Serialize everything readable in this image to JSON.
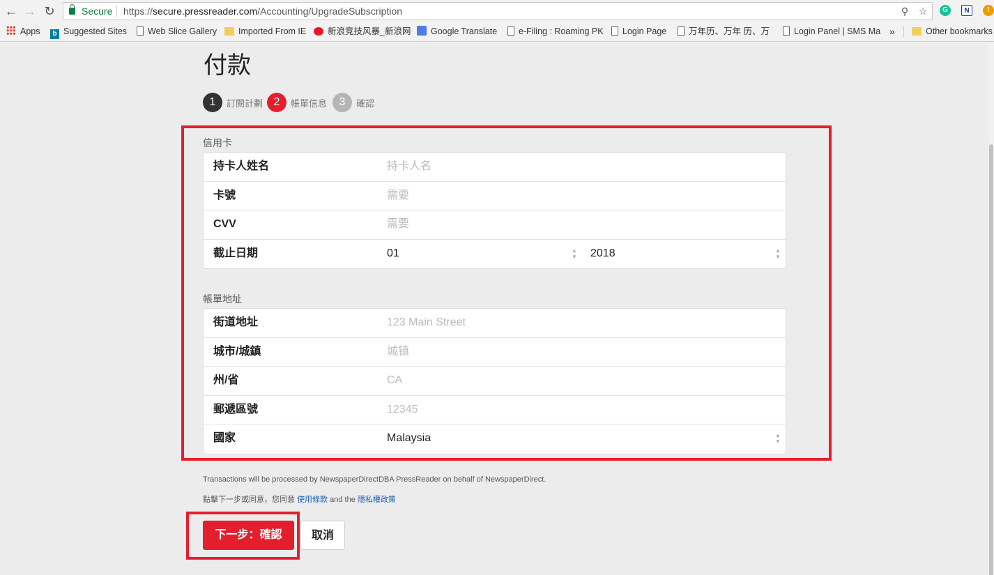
{
  "browser": {
    "secure_label": "Secure",
    "url_scheme": "https://",
    "url_host": "secure.pressreader.com",
    "url_path": "/Accounting/UpgradeSubscription",
    "bookmarks": [
      {
        "label": "Apps",
        "icon": "apps-icon"
      },
      {
        "label": "Suggested Sites",
        "icon": "bing-icon"
      },
      {
        "label": "Web Slice Gallery",
        "icon": "file-icon"
      },
      {
        "label": "Imported From IE",
        "icon": "folder-icon"
      },
      {
        "label": "新浪竞技风暴_新浪网",
        "icon": "weibo-icon"
      },
      {
        "label": "Google Translate",
        "icon": "google-translate-icon"
      },
      {
        "label": "e-Filing : Roaming PK",
        "icon": "file-icon"
      },
      {
        "label": "Login Page",
        "icon": "file-icon"
      },
      {
        "label": "万年历、万年 历、万",
        "icon": "file-icon"
      },
      {
        "label": "Login Panel | SMS Ma",
        "icon": "file-icon"
      }
    ],
    "overflow_label": "»",
    "other_bookmarks": "Other bookmarks"
  },
  "page": {
    "title": "付款",
    "steps": [
      {
        "number": "1",
        "label": "訂閱計劃",
        "color": "#333333"
      },
      {
        "number": "2",
        "label": "帳單信息",
        "color": "#e31e2d"
      },
      {
        "number": "3",
        "label": "確認",
        "color": "#b5b5b5"
      }
    ],
    "credit_card": {
      "section_label": "信用卡",
      "cardholder_label": "持卡人姓名",
      "cardholder_placeholder": "持卡人名",
      "card_number_label": "卡號",
      "card_number_placeholder": "需要",
      "cvv_label": "CVV",
      "cvv_placeholder": "需要",
      "expiry_label": "截止日期",
      "expiry_month": "01",
      "expiry_year": "2018"
    },
    "billing_address": {
      "section_label": "帳單地址",
      "street_label": "街道地址",
      "street_placeholder": "123 Main Street",
      "city_label": "城市/城鎮",
      "city_placeholder": "城镇",
      "state_label": "州/省",
      "state_placeholder": "CA",
      "zip_label": "郵遞區號",
      "zip_placeholder": "12345",
      "country_label": "國家",
      "country_value": "Malaysia"
    },
    "disclaimer": "Transactions will be processed by NewspaperDirectDBA PressReader on behalf of NewspaperDirect.",
    "agree_prefix": "點擊下一步或同意，您同意",
    "terms_link": "使用條款",
    "agree_and": "and the",
    "privacy_link": "隱私權政策",
    "next_button": "下一步：確認",
    "cancel_button": "取消"
  }
}
